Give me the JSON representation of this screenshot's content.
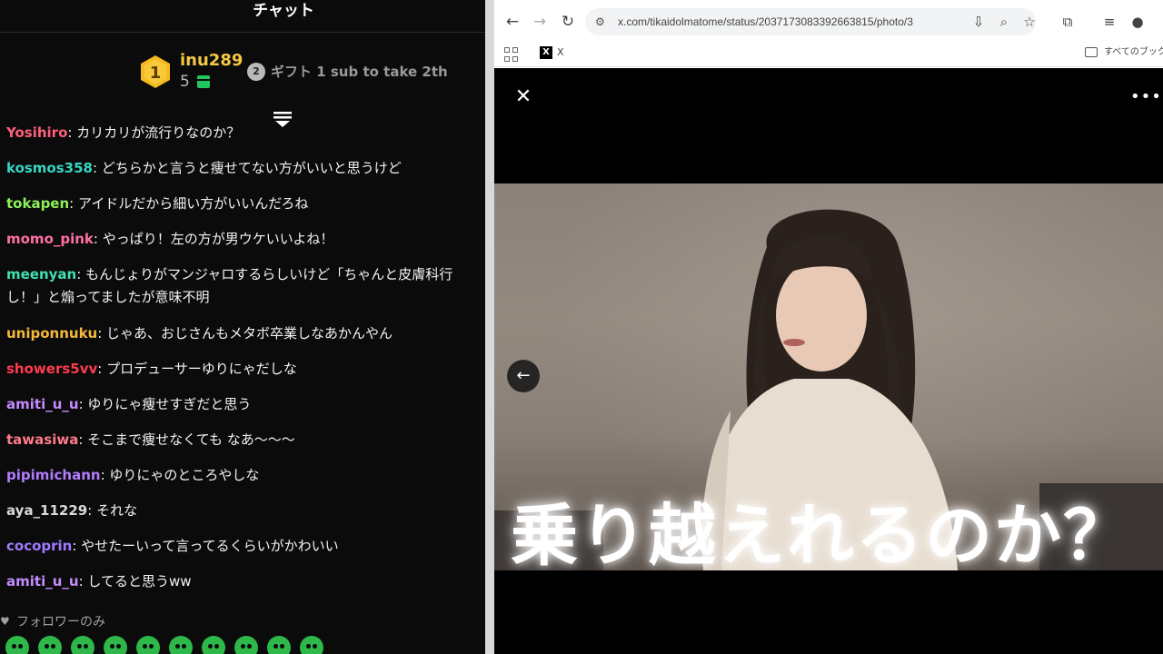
{
  "chat": {
    "title": "チャット",
    "top_gifter": {
      "rank": "1",
      "name": "inu289",
      "count": "5"
    },
    "second_gifter": {
      "rank": "2",
      "text": "ギフト 1 sub to take 2th"
    },
    "messages": [
      {
        "user": "Yosihiro",
        "color": "#ff5f7a",
        "text": ": カリカリが流行りなのか？"
      },
      {
        "user": "kosmos358",
        "color": "#36d6c3",
        "text": ": どちらかと言うと痩せてない方がいいと思うけど"
      },
      {
        "user": "tokapen",
        "color": "#8cf25a",
        "text": ": アイドルだから細い方がいいんだろね"
      },
      {
        "user": "momo_pink",
        "color": "#ff6fa6",
        "text": ": やっぱり！左の方が男ウケいいよね！"
      },
      {
        "user": "meenyan",
        "color": "#3fe0b0",
        "text": ": もんじょりがマンジャロするらしいけど「ちゃんと皮膚科行\nし！」と煽ってましたが意味不明"
      },
      {
        "user": "uniponnuku",
        "color": "#f5b93c",
        "text": ": じゃあ、おじさんもメタボ卒業しなあかんやん"
      },
      {
        "user": "showers5vv",
        "color": "#ff3b4f",
        "text": ": プロデューサーゆりにゃだしな"
      },
      {
        "user": "amiti_u_u",
        "color": "#c58cff",
        "text": ": ゆりにゃ痩せすぎだと思う"
      },
      {
        "user": "tawasiwa",
        "color": "#ff7a8a",
        "text": ": そこまで痩せなくても なあ〜〜〜"
      },
      {
        "user": "pipimichann",
        "color": "#b47cff",
        "text": ": ゆりにゃのところやしな"
      },
      {
        "user": "aya_11229",
        "color": "#d9d9d9",
        "text": ": それな"
      },
      {
        "user": "cocoprin",
        "color": "#a07bff",
        "text": ": やせたーいって言ってるくらいがかわいい"
      },
      {
        "user": "amiti_u_u",
        "color": "#c58cff",
        "text": ": してると思うww"
      }
    ],
    "followers_only": "フォロワーのみ"
  },
  "browser": {
    "url": "x.com/tikaidolmatome/status/2037173083392663815/photo/3",
    "bookmark_x_label": "X",
    "bookmark_all": "すべてのブックマ-"
  },
  "viewer": {
    "caption": "乗り越えれるのか？"
  }
}
